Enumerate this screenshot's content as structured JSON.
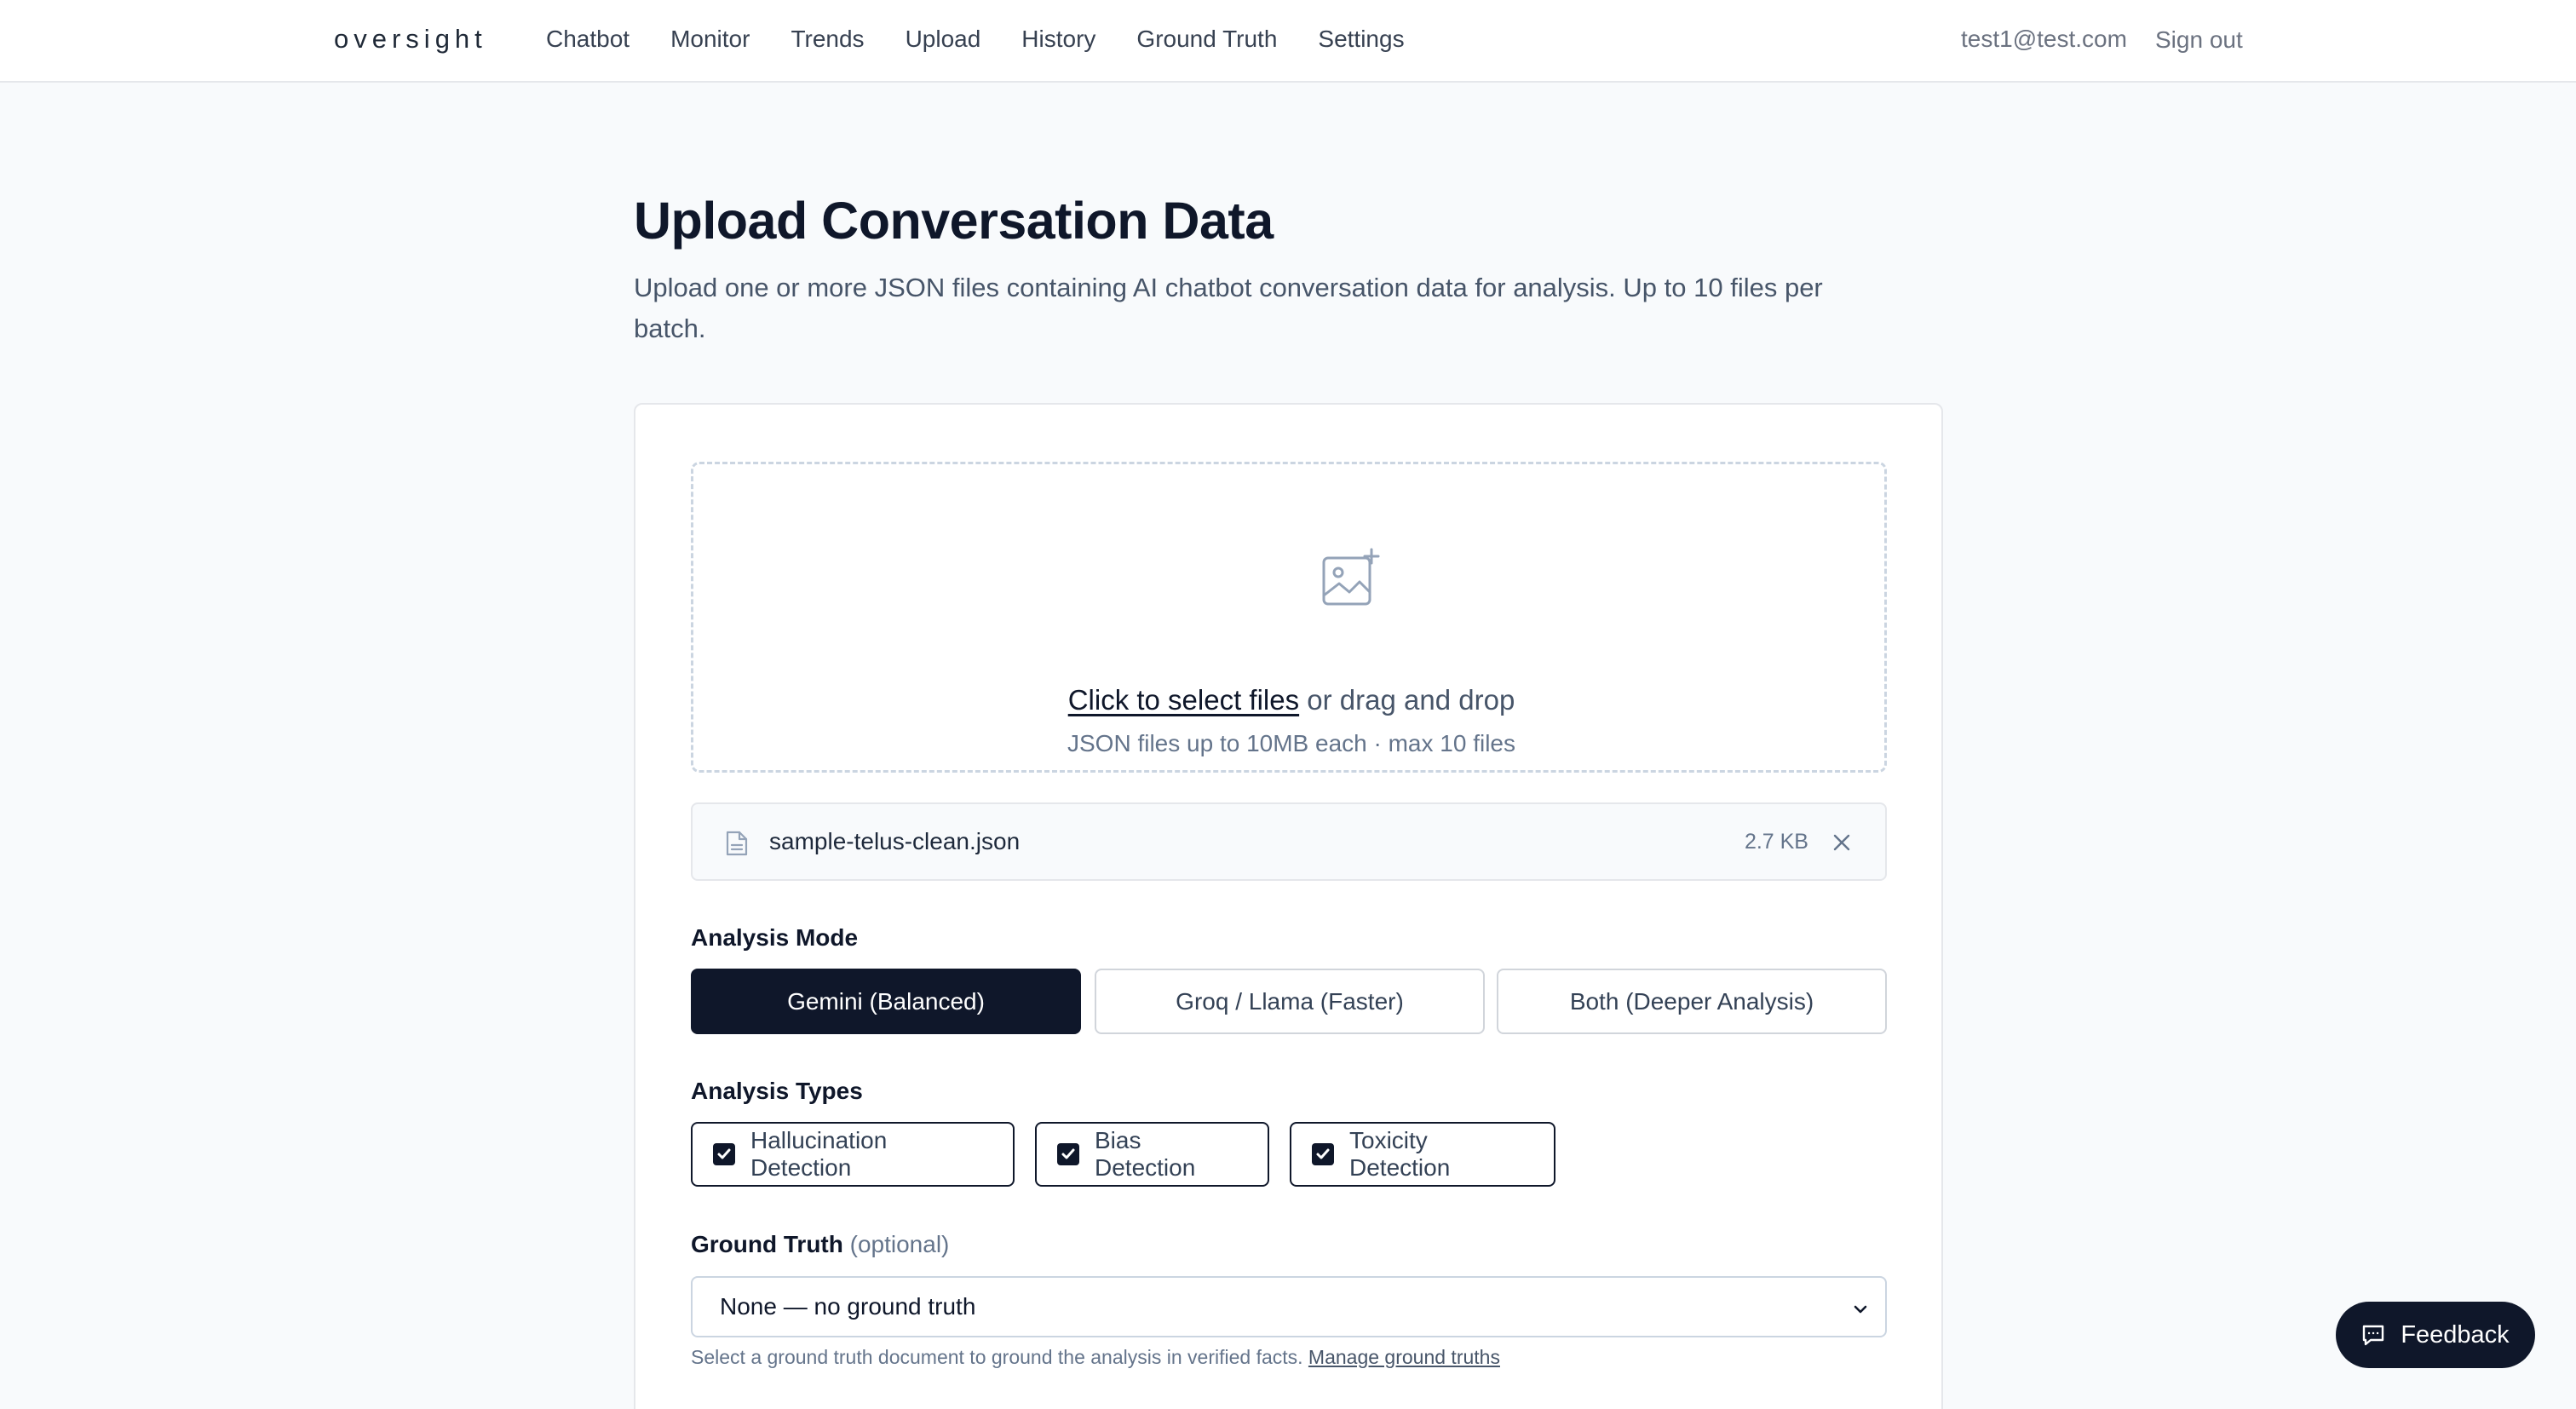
{
  "app": {
    "logo": "oversight"
  },
  "nav": {
    "items": [
      {
        "label": "Chatbot"
      },
      {
        "label": "Monitor"
      },
      {
        "label": "Trends"
      },
      {
        "label": "Upload"
      },
      {
        "label": "History"
      },
      {
        "label": "Ground Truth"
      },
      {
        "label": "Settings"
      }
    ],
    "user_email": "test1@test.com",
    "sign_out": "Sign out"
  },
  "page": {
    "title": "Upload Conversation Data",
    "subtitle": "Upload one or more JSON files containing AI chatbot conversation data for analysis. Up to 10 files per batch."
  },
  "dropzone": {
    "icon": "image-plus-icon",
    "link_text": "Click to select files",
    "rest_text": " or drag and drop",
    "hint": "JSON files up to 10MB each · max 10 files"
  },
  "files": [
    {
      "name": "sample-telus-clean.json",
      "size": "2.7 KB",
      "icon": "file-icon"
    }
  ],
  "analysis_mode": {
    "label": "Analysis Mode",
    "options": [
      {
        "label": "Gemini (Balanced)",
        "selected": true
      },
      {
        "label": "Groq / Llama (Faster)",
        "selected": false
      },
      {
        "label": "Both (Deeper Analysis)",
        "selected": false
      }
    ]
  },
  "analysis_types": {
    "label": "Analysis Types",
    "options": [
      {
        "label": "Hallucination Detection",
        "checked": true
      },
      {
        "label": "Bias Detection",
        "checked": true
      },
      {
        "label": "Toxicity Detection",
        "checked": true
      }
    ]
  },
  "ground_truth": {
    "label": "Ground Truth",
    "optional": "(optional)",
    "selected": "None — no ground truth",
    "help": "Select a ground truth document to ground the analysis in verified facts. ",
    "manage_link": "Manage ground truths"
  },
  "feedback": {
    "label": "Feedback",
    "icon": "chat-icon"
  },
  "colors": {
    "primary": "#0f172a",
    "muted": "#64748b",
    "border": "#e5e7eb"
  }
}
